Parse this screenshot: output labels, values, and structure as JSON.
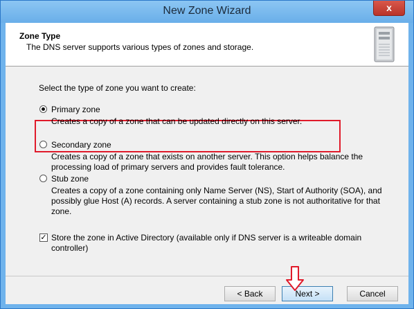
{
  "window": {
    "title": "New Zone Wizard",
    "close_label": "x"
  },
  "header": {
    "title": "Zone Type",
    "subtitle": "The DNS server supports various types of zones and storage."
  },
  "prompt": "Select the type of zone you want to create:",
  "options": [
    {
      "label": "Primary zone",
      "selected": true,
      "desc": "Creates a copy of a zone that can be updated directly on this server."
    },
    {
      "label": "Secondary zone",
      "selected": false,
      "desc": "Creates a copy of a zone that exists on another server. This option helps balance the processing load of primary servers and provides fault tolerance."
    },
    {
      "label": "Stub zone",
      "selected": false,
      "desc": "Creates a copy of a zone containing only Name Server (NS), Start of Authority (SOA), and possibly glue Host (A) records. A server containing a stub zone is not authoritative for that zone."
    }
  ],
  "checkbox": {
    "checked": true,
    "label": "Store the zone in Active Directory (available only if DNS server is a writeable domain controller)"
  },
  "buttons": {
    "back": "< Back",
    "next": "Next >",
    "cancel": "Cancel"
  },
  "annotation": {
    "color": "#e01a2a"
  }
}
